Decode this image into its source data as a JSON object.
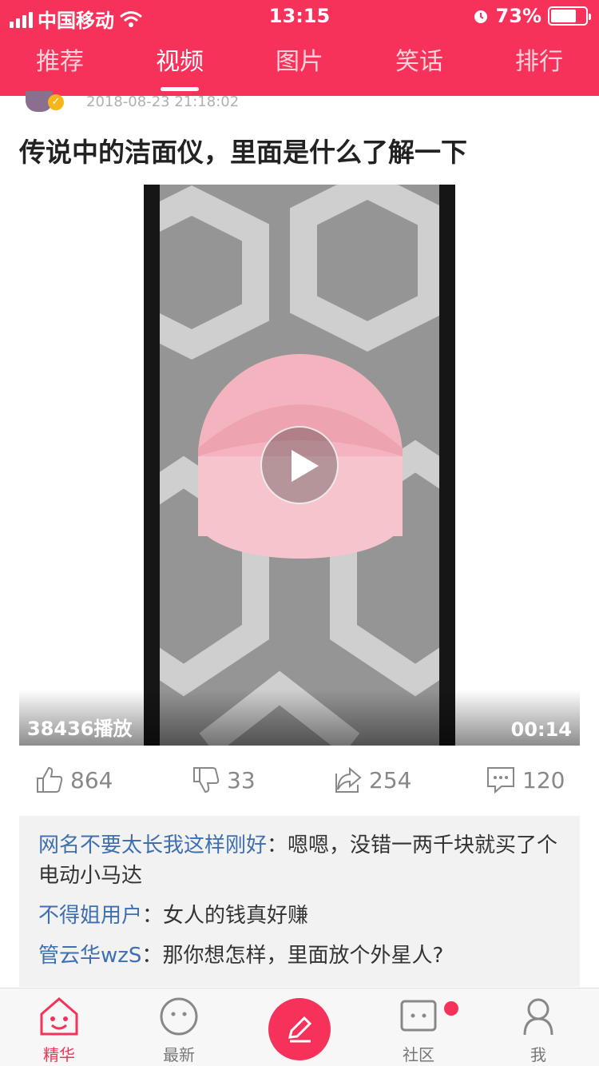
{
  "status_bar": {
    "carrier": "中国移动",
    "time": "13:15",
    "battery_percent": "73%",
    "battery_level": 0.73
  },
  "top_tabs": [
    {
      "label": "推荐",
      "active": false
    },
    {
      "label": "视频",
      "active": true
    },
    {
      "label": "图片",
      "active": false
    },
    {
      "label": "笑话",
      "active": false
    },
    {
      "label": "排行",
      "active": false
    }
  ],
  "post": {
    "timestamp": "2018-08-23 21:18:02",
    "title": "传说中的洁面仪，里面是什么了解一下",
    "play_count": "38436播放",
    "duration": "00:14",
    "likes": "864",
    "dislikes": "33",
    "shares": "254",
    "comments_count": "120"
  },
  "comments": [
    {
      "user": "网名不要太长我这样刚好",
      "text": "嗯嗯，没错一两千块就买了个电动小马达"
    },
    {
      "user": "不得姐用户",
      "text": "女人的钱真好赚"
    },
    {
      "user": "管云华wzS",
      "text": "那你想怎样，里面放个外星人?"
    }
  ],
  "bottom_nav": {
    "featured": "精华",
    "latest": "最新",
    "community": "社区",
    "me": "我"
  },
  "colors": {
    "brand": "#f7325a",
    "comment_user": "#3e6fb0"
  }
}
